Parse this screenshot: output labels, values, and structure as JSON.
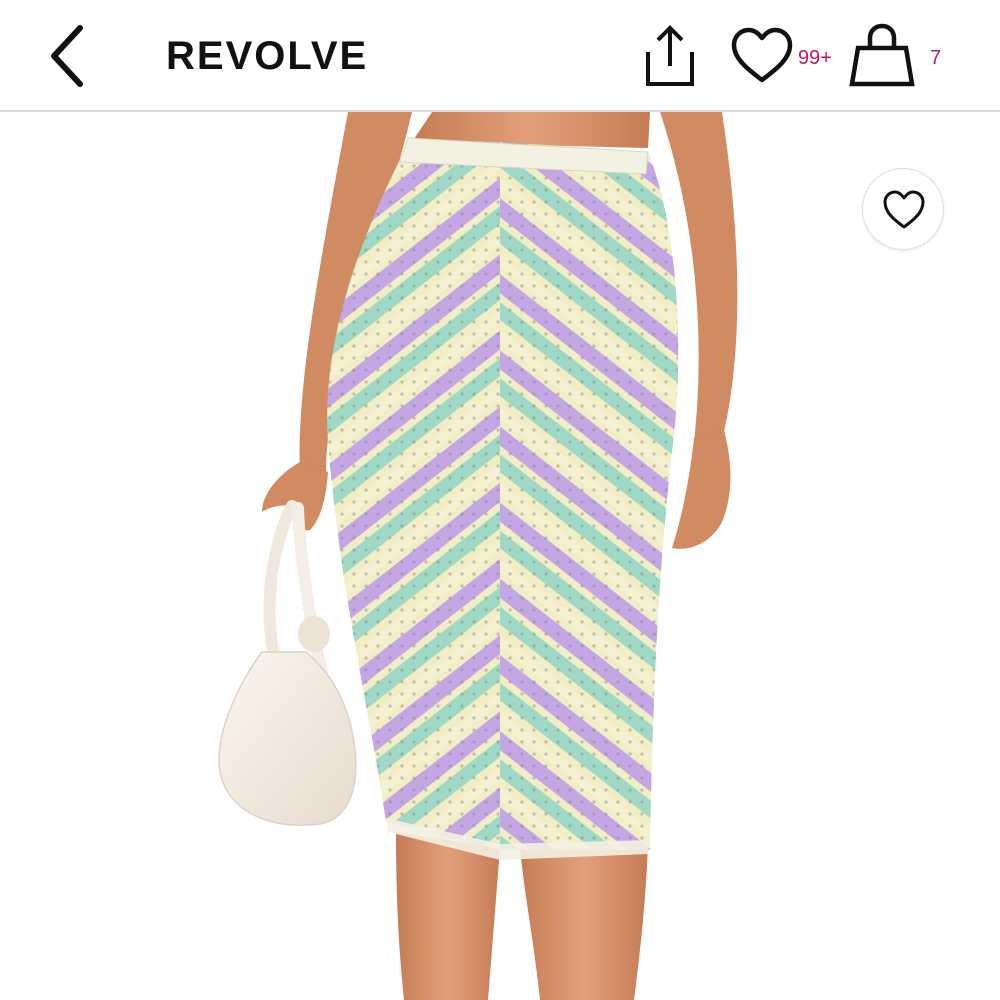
{
  "header": {
    "back_icon": "chevron-left-icon",
    "brand": "REVOLVE",
    "share_icon": "share-icon",
    "wishlist_icon": "heart-icon",
    "wishlist_count": "99+",
    "bag_icon": "shopping-bag-icon",
    "bag_count": "7"
  },
  "product": {
    "image_icon": "product-photo",
    "favorite_icon": "heart-icon"
  },
  "colors": {
    "badge": "#c2185b",
    "text": "#111111",
    "divider": "#dcdcdc",
    "skirt_lilac": "#c4a6e4",
    "skirt_mint": "#9fd8c4",
    "skirt_cream": "#f1edc4",
    "bag": "#f3ece2",
    "skin": "#d9936a"
  }
}
